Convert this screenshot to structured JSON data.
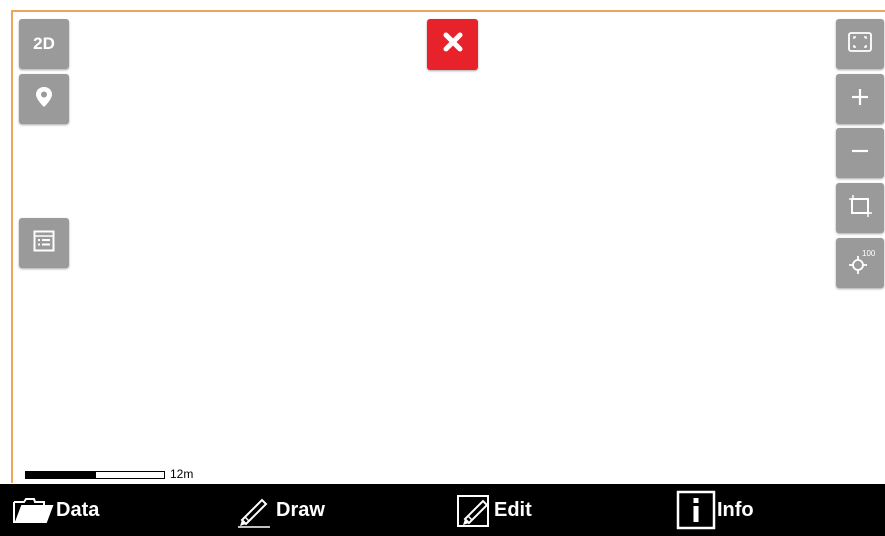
{
  "left_toolbar": {
    "view_mode_label": "2D",
    "location_icon": "map-pin-icon",
    "legend_icon": "layer-list-icon"
  },
  "close_button": {
    "icon": "close-x-icon",
    "color": "#e8222a"
  },
  "right_toolbar": {
    "fullscreen_icon": "fullscreen-icon",
    "zoom_in_icon": "plus-icon",
    "zoom_out_icon": "minus-icon",
    "select_area_icon": "crop-icon",
    "gps_icon": "gps-crosshair-icon",
    "gps_accuracy_label": "100"
  },
  "scale_bar": {
    "label": "12m"
  },
  "bottom_nav": {
    "items": [
      {
        "label": "Data",
        "icon": "folder-icon"
      },
      {
        "label": "Draw",
        "icon": "pencil-icon"
      },
      {
        "label": "Edit",
        "icon": "edit-icon"
      },
      {
        "label": "Info",
        "icon": "info-icon"
      }
    ]
  },
  "colors": {
    "toolbar_button": "#9a9a9a",
    "close_button": "#e8222a",
    "map_border": "#f0a45a",
    "bottom_bar": "#000000"
  }
}
